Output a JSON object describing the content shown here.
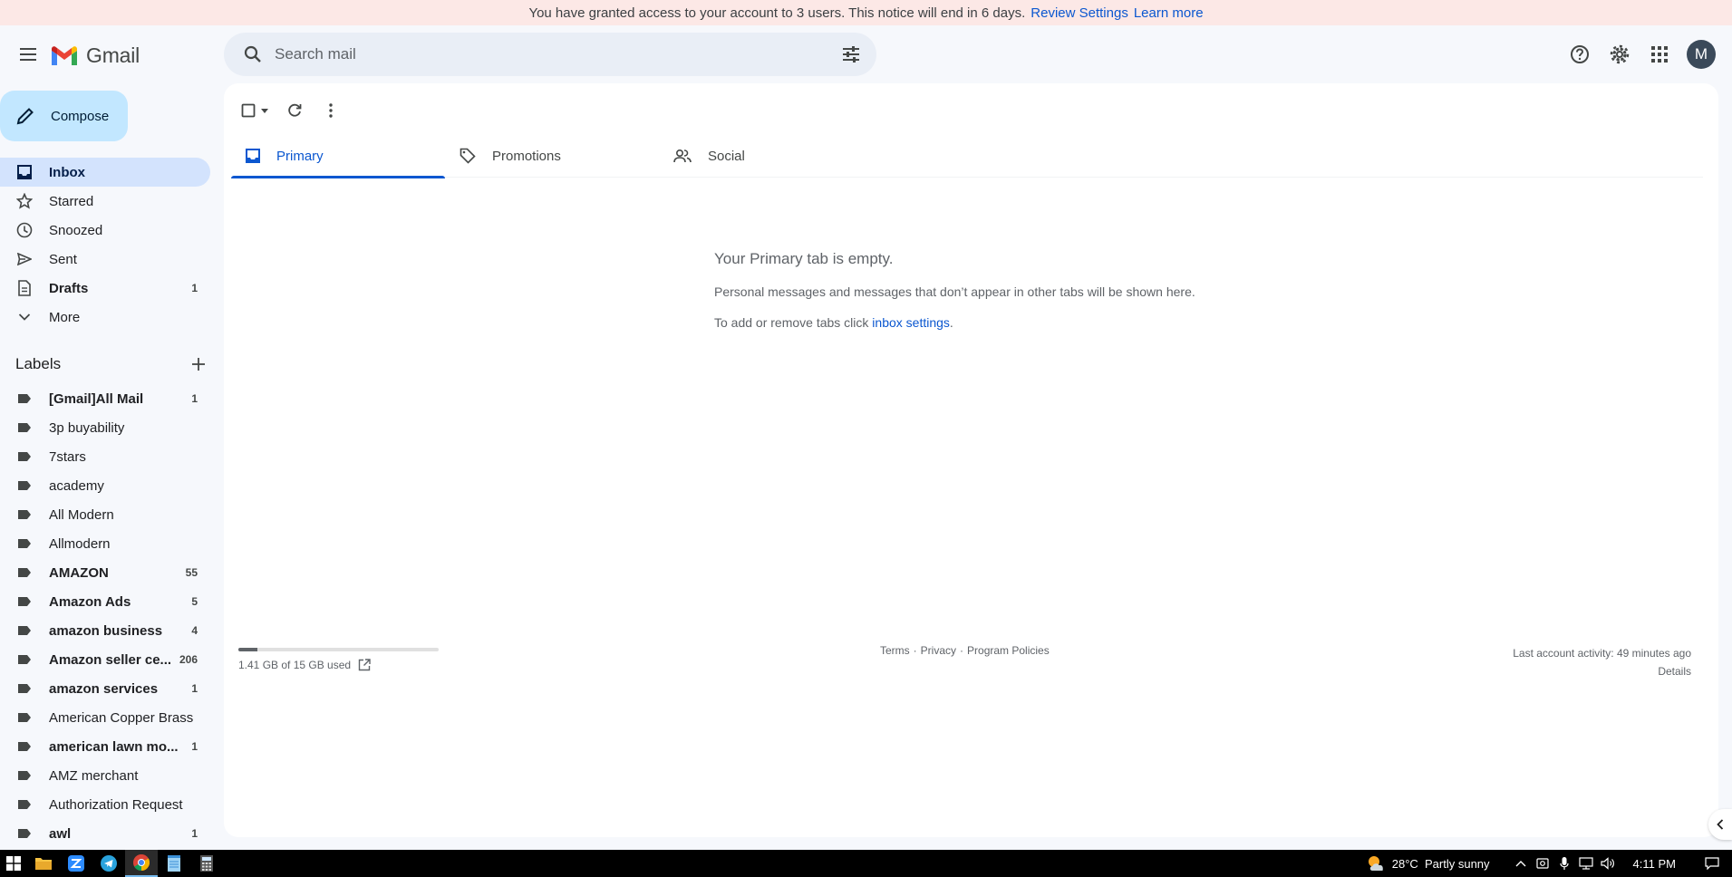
{
  "notice": {
    "text": "You have granted access to your account to 3 users. This notice will end in 6 days.",
    "review_link": "Review Settings",
    "learn_link": "Learn more"
  },
  "header": {
    "app_name": "Gmail",
    "search_placeholder": "Search mail",
    "avatar_letter": "M",
    "icons": [
      "menu-icon",
      "gmail-logo",
      "search-icon",
      "search-options-icon",
      "help-icon",
      "settings-icon",
      "apps-grid-icon"
    ]
  },
  "compose": {
    "label": "Compose"
  },
  "nav": {
    "items": [
      {
        "label": "Inbox",
        "count": "",
        "icon": "inbox-icon"
      },
      {
        "label": "Starred",
        "count": "",
        "icon": "star-icon"
      },
      {
        "label": "Snoozed",
        "count": "",
        "icon": "clock-icon"
      },
      {
        "label": "Sent",
        "count": "",
        "icon": "send-icon"
      },
      {
        "label": "Drafts",
        "count": "1",
        "icon": "draft-icon"
      },
      {
        "label": "More",
        "count": "",
        "icon": "chevron-down-icon"
      }
    ]
  },
  "labels": {
    "title": "Labels",
    "items": [
      {
        "label": "[Gmail]All Mail",
        "count": "1"
      },
      {
        "label": "3p buyability",
        "count": ""
      },
      {
        "label": "7stars",
        "count": ""
      },
      {
        "label": "academy",
        "count": ""
      },
      {
        "label": "All Modern",
        "count": ""
      },
      {
        "label": "Allmodern",
        "count": ""
      },
      {
        "label": "AMAZON",
        "count": "55"
      },
      {
        "label": "Amazon Ads",
        "count": "5"
      },
      {
        "label": "amazon business",
        "count": "4"
      },
      {
        "label": "Amazon seller ce...",
        "count": "206"
      },
      {
        "label": "amazon services",
        "count": "1"
      },
      {
        "label": "American Copper Brass",
        "count": ""
      },
      {
        "label": "american lawn mo...",
        "count": "1"
      },
      {
        "label": "AMZ merchant",
        "count": ""
      },
      {
        "label": "Authorization Request",
        "count": ""
      },
      {
        "label": "awl",
        "count": "1"
      }
    ]
  },
  "tabs": [
    {
      "label": "Primary",
      "icon": "inbox-icon"
    },
    {
      "label": "Promotions",
      "icon": "tag-icon"
    },
    {
      "label": "Social",
      "icon": "people-icon"
    }
  ],
  "empty": {
    "title": "Your Primary tab is empty.",
    "line1": "Personal messages and messages that don’t appear in other tabs will be shown here.",
    "line2_prefix": "To add or remove tabs click",
    "line2_link": "inbox settings",
    "line2_suffix": "."
  },
  "footer": {
    "storage_text": "1.41 GB of 15 GB used",
    "storage_fraction": 0.094,
    "terms": "Terms",
    "sep": "·",
    "privacy": "Privacy",
    "policies": "Program Policies",
    "last_activity": "Last account activity: 49 minutes ago",
    "details": "Details"
  },
  "taskbar": {
    "weather": "28°C  Partly sunny",
    "time": "4:11 PM",
    "apps": [
      "windows-start-icon",
      "file-explorer-icon",
      "zoom-icon",
      "telegram-icon",
      "chrome-icon",
      "notepad-icon",
      "calculator-icon"
    ]
  },
  "colors": {
    "accent": "#0b57d0",
    "compose_bg": "#c2e7ff",
    "active_nav_bg": "#d3e3fd",
    "notice_bg": "#fce8e6",
    "page_bg": "#f6f8fc"
  }
}
